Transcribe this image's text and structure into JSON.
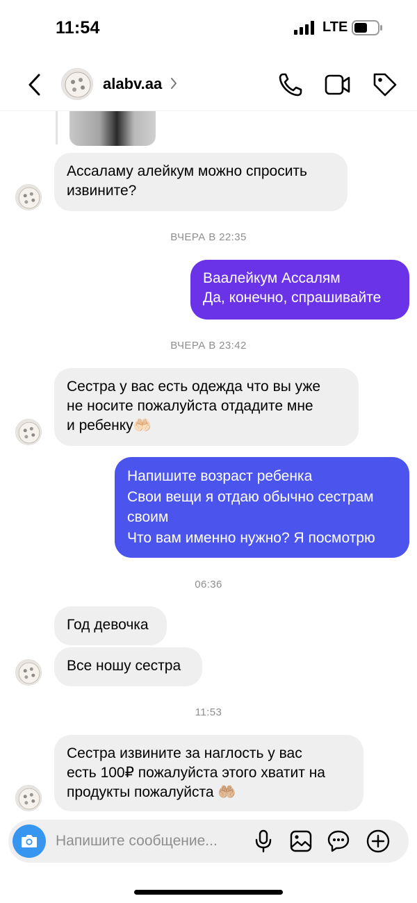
{
  "status_bar": {
    "time": "11:54",
    "network": "LTE"
  },
  "header": {
    "contact_name": "alabv.aa",
    "icons": [
      "back-arrow-icon",
      "phone-icon",
      "video-camera-icon",
      "tag-icon"
    ]
  },
  "messages": [
    {
      "direction": "incoming",
      "lines": [
        "Ассаламу алейкум можно спросить",
        "извините?"
      ]
    },
    {
      "timestamp": "ВЧЕРА В 22:35"
    },
    {
      "direction": "outgoing",
      "lines": [
        "Ваалейкум Ассалям",
        "Да, конечно, спрашивайте"
      ]
    },
    {
      "timestamp": "ВЧЕРА В 23:42"
    },
    {
      "direction": "incoming",
      "lines": [
        "Сестра у вас есть одежда что вы уже",
        "не носите пожалуйста отдадите мне",
        "и ребенку🤲🏻"
      ]
    },
    {
      "direction": "outgoing",
      "lines": [
        "Напишите возраст ребенка",
        "Свои вещи я отдаю обычно сестрам",
        "своим",
        "Что вам именно нужно? Я посмотрю"
      ]
    },
    {
      "timestamp": "06:36"
    },
    {
      "direction": "incoming",
      "lines": [
        "Год девочка"
      ]
    },
    {
      "direction": "incoming",
      "lines": [
        "Все ношу сестра"
      ]
    },
    {
      "timestamp": "11:53"
    },
    {
      "direction": "incoming",
      "lines": [
        "Сестра извините за наглость у вас",
        "есть 100₽ пожалуйста этого хватит на",
        "продукты пожалуйста 🤲🏼"
      ]
    }
  ],
  "composer": {
    "placeholder": "Напишите сообщение..."
  },
  "colors": {
    "incoming_bubble": "#efefef",
    "outgoing_bubble_1": "#6a33e8",
    "outgoing_bubble_2": "#4b55ee",
    "camera_button": "#3797f0",
    "timestamp_text": "#8e8e8e"
  }
}
